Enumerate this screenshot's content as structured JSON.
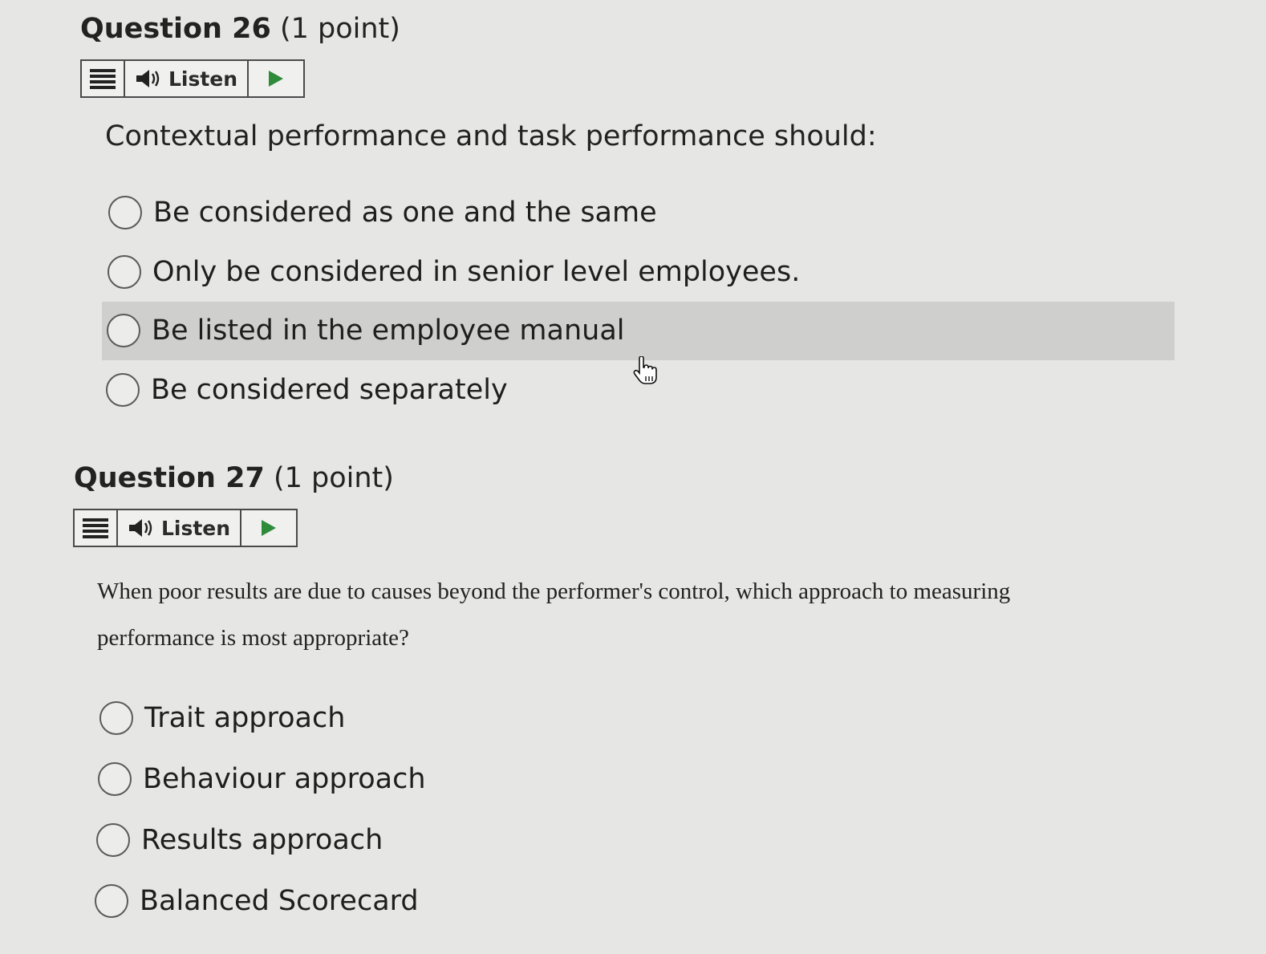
{
  "questions": [
    {
      "number_label": "Question 26",
      "points_label": "(1 point)",
      "listen_label": "Listen",
      "prompt": "Contextual performance and task performance should:",
      "options": [
        "Be considered as one and the same",
        "Only be considered in senior level employees.",
        "Be listed in the employee manual",
        "Be considered separately"
      ]
    },
    {
      "number_label": "Question 27",
      "points_label": "(1 point)",
      "listen_label": "Listen",
      "prompt_line1": "When poor results are due to causes beyond the performer's control, which approach to measuring",
      "prompt_line2": "performance is most appropriate?",
      "options": [
        "Trait approach",
        "Behaviour approach",
        "Results approach",
        "Balanced Scorecard"
      ]
    }
  ],
  "icons": {
    "menu": "menu-icon",
    "speaker": "speaker-icon",
    "play": "play-icon",
    "cursor": "hand-pointer-icon"
  },
  "colors": {
    "page_background": "#e6e6e4",
    "hover_highlight": "#cfcfcd",
    "play_green": "#2e8b3a"
  }
}
